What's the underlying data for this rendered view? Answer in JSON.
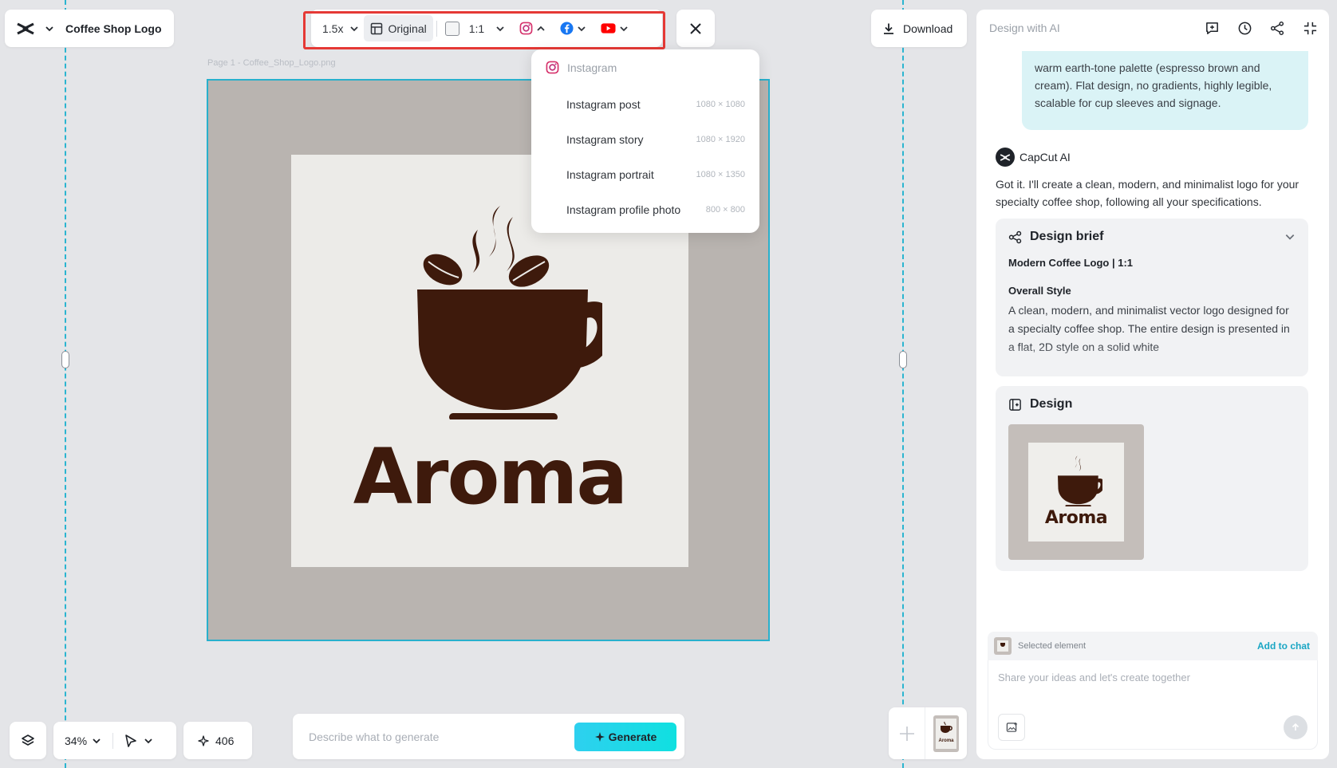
{
  "app": {
    "title": "Coffee Shop Logo"
  },
  "toolbar": {
    "scale": "1.5x",
    "original_label": "Original",
    "ratio": "1:1"
  },
  "canvas": {
    "page_label": "Page 1 -   Coffee_Shop_Logo.png",
    "logo_text": "Aroma"
  },
  "dropdown": {
    "header": "Instagram",
    "items": [
      {
        "label": "Instagram post",
        "size": "1080 × 1080"
      },
      {
        "label": "Instagram story",
        "size": "1080 × 1920"
      },
      {
        "label": "Instagram portrait",
        "size": "1080 × 1350"
      },
      {
        "label": "Instagram profile photo",
        "size": "800 × 800"
      }
    ]
  },
  "download_label": "Download",
  "bottom": {
    "zoom": "34%",
    "credits": "406",
    "prompt_placeholder": "Describe what to generate",
    "generate_label": "Generate",
    "thumb_text": "Aroma"
  },
  "panel": {
    "title": "Design with AI",
    "user_message": "warm earth-tone palette (espresso brown and cream). Flat design, no gradients, highly legible, scalable for cup sleeves and signage.",
    "ai_name": "CapCut AI",
    "ai_message": "Got it. I'll create a clean, modern, and minimalist logo for your specialty coffee shop, following all your specifications.",
    "brief": {
      "title": "Design brief",
      "subtitle": "Modern Coffee Logo | 1:1",
      "heading": "Overall Style",
      "body": "A clean, modern, and minimalist vector logo designed for a specialty coffee shop. The entire design is presented in a flat, 2D style on a solid white"
    },
    "design": {
      "title": "Design",
      "thumb_text": "Aroma"
    },
    "selected_label": "Selected element",
    "add_to_chat": "Add to chat",
    "chat_placeholder": "Share your ideas and let's create together"
  },
  "colors": {
    "accent": "#29b0cc",
    "coffee": "#3e1a0c",
    "highlight": "#e53935"
  }
}
